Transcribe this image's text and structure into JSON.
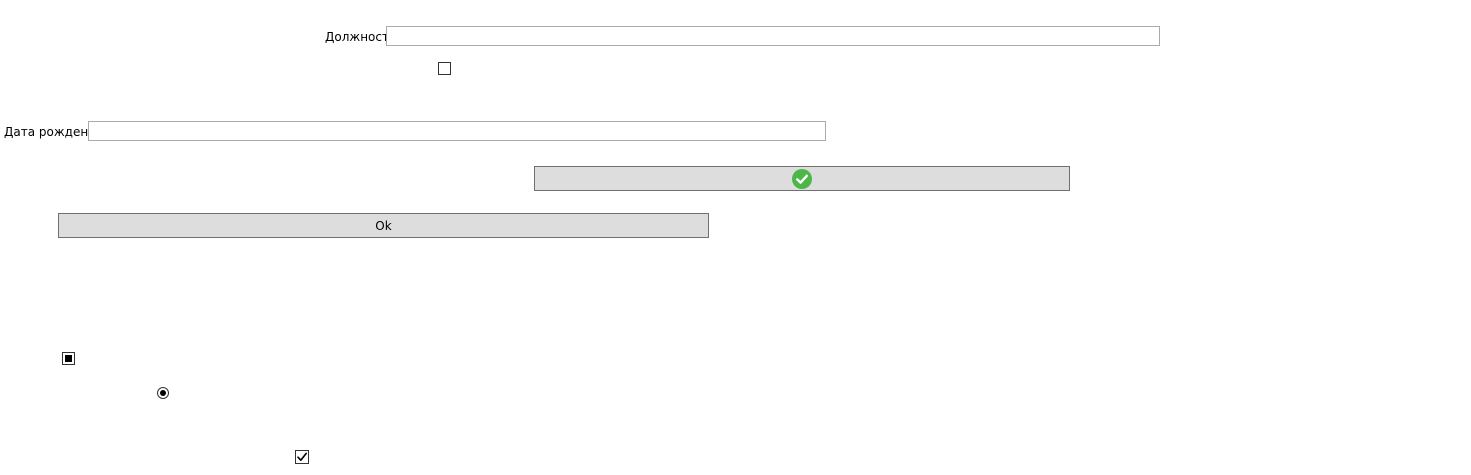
{
  "form": {
    "position_label": "Должность",
    "position_value": "",
    "birthdate_label": "Дата рождения",
    "birthdate_value": "",
    "ok_button_label": "Ok"
  },
  "icons": {
    "confirm_button_icon": "check-circle-icon",
    "confirm_icon_color": "#4cb648"
  },
  "controls": {
    "checkbox_top_checked": false,
    "checkbox_indeterminate_state": "indeterminate",
    "radio_selected": true,
    "checkbox_bottom_checked": true
  }
}
